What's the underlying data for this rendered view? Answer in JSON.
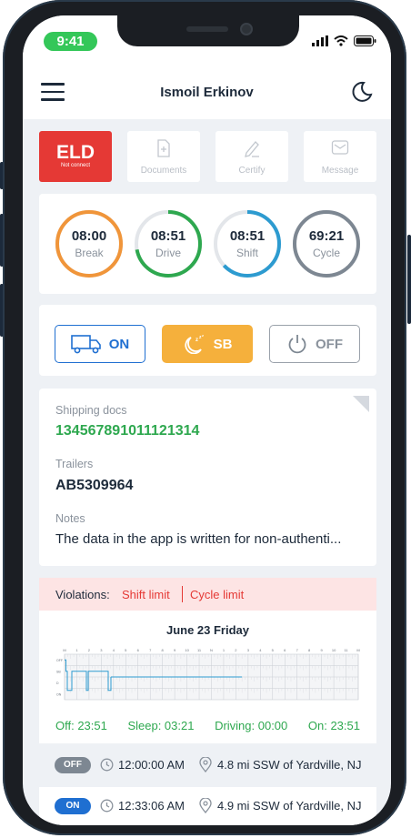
{
  "status_bar": {
    "time": "9:41"
  },
  "header": {
    "title": "Ismoil Erkinov"
  },
  "quick_actions": {
    "eld": {
      "label": "ELD",
      "status": "Not connect"
    },
    "documents": "Documents",
    "certify": "Certify",
    "message": "Message"
  },
  "clocks": [
    {
      "time": "08:00",
      "label": "Break",
      "color": "#f0953a",
      "progress": 1.0
    },
    {
      "time": "08:51",
      "label": "Drive",
      "color": "#2ea84f",
      "progress": 0.72
    },
    {
      "time": "08:51",
      "label": "Shift",
      "color": "#2d9bd0",
      "progress": 0.63
    },
    {
      "time": "69:21",
      "label": "Cycle",
      "color": "#7d8792",
      "progress": 1.0
    }
  ],
  "duty_status": {
    "on": "ON",
    "sb": "SB",
    "off": "OFF"
  },
  "shipping": {
    "docs_label": "Shipping docs",
    "docs_value": "134567891011121314",
    "trailers_label": "Trailers",
    "trailers_value": "AB5309964",
    "notes_label": "Notes",
    "notes_value": "The data in the app is written for non-authenti..."
  },
  "violations": {
    "label": "Violations:",
    "items": [
      "Shift limit",
      "Cycle limit"
    ]
  },
  "log": {
    "date": "June 23 Friday",
    "hours": [
      "M",
      "1",
      "2",
      "3",
      "4",
      "5",
      "6",
      "7",
      "8",
      "9",
      "10",
      "11",
      "N",
      "1",
      "2",
      "3",
      "4",
      "5",
      "6",
      "7",
      "8",
      "9",
      "10",
      "11",
      "M"
    ],
    "rows": [
      "OFF",
      "SB",
      "D",
      "ON"
    ],
    "totals": {
      "off": "Off: 23:51",
      "sleep": "Sleep: 03:21",
      "driving": "Driving: 00:00",
      "on": "On: 23:51"
    }
  },
  "events": [
    {
      "status": "OFF",
      "color": "#7d8792",
      "time": "12:00:00 AM",
      "location": "4.8 mi SSW of Yardville, NJ"
    },
    {
      "status": "ON",
      "color": "#1f6fd1",
      "time": "12:33:06 AM",
      "location": "4.9 mi SSW of Yardville, NJ"
    }
  ],
  "colors": {
    "accent_red": "#e53935",
    "sb_orange": "#f5b03c",
    "on_blue": "#1f6fd1",
    "green": "#2ea84f"
  }
}
